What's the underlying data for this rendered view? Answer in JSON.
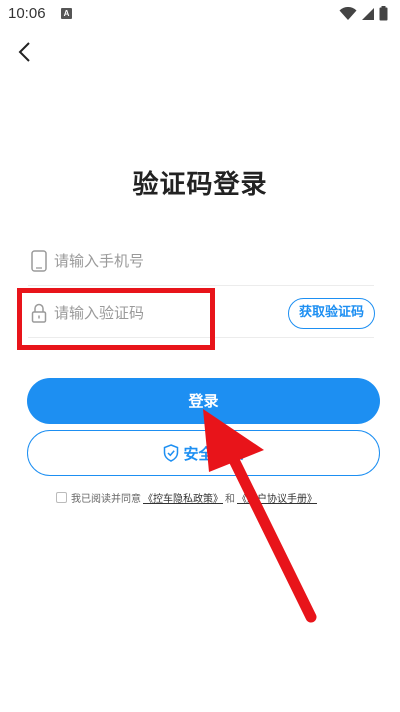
{
  "status_bar": {
    "time": "10:06",
    "notification_letter": "A"
  },
  "page": {
    "title": "验证码登录"
  },
  "phone_field": {
    "placeholder": "请输入手机号",
    "value": ""
  },
  "code_field": {
    "placeholder": "请输入验证码",
    "value": ""
  },
  "buttons": {
    "get_code": "获取验证码",
    "login": "登录",
    "secure_login": "安全登录"
  },
  "agreement": {
    "prefix": "我已阅读并同意",
    "privacy_link": "《控车隐私政策》",
    "connector": "和",
    "user_agreement_link": "《用户协议手册》",
    "checked": false
  },
  "annotation_colors": {
    "highlight": "#e8141a",
    "arrow": "#e8141a"
  },
  "theme": {
    "accent": "#1d8ff2"
  },
  "icons": [
    "back-arrow-icon",
    "phone-icon",
    "lock-icon",
    "shield-check-icon",
    "wifi-icon",
    "signal-icon",
    "battery-icon"
  ]
}
